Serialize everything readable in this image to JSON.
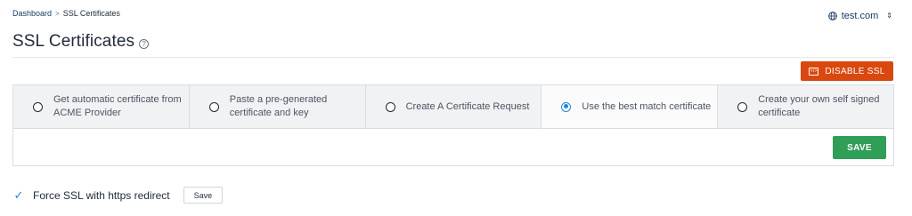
{
  "breadcrumb": {
    "items": [
      {
        "label": "Dashboard"
      },
      {
        "label": "SSL Certificates"
      }
    ],
    "separator": ">"
  },
  "domain_selector": {
    "value": "test.com",
    "icon": "globe-icon"
  },
  "page": {
    "title": "SSL Certificates",
    "help_icon": "?"
  },
  "actions": {
    "disable_ssl_label": "DISABLE SSL",
    "disable_ssl_color": "#d9480f"
  },
  "certificate_options": [
    {
      "label": "Get automatic certificate from ACME Provider",
      "selected": false
    },
    {
      "label": "Paste a pre-generated certificate and key",
      "selected": false
    },
    {
      "label": "Create A Certificate Request",
      "selected": false
    },
    {
      "label": "Use the best match certificate",
      "selected": true
    },
    {
      "label": "Create your own self signed certificate",
      "selected": false
    }
  ],
  "panel": {
    "save_label": "SAVE",
    "save_color": "#2f9e57"
  },
  "force_ssl": {
    "label": "Force SSL with https redirect",
    "checked": true,
    "save_label": "Save"
  },
  "colors": {
    "accent": "#2684d8",
    "text": "#1f2a3a"
  }
}
